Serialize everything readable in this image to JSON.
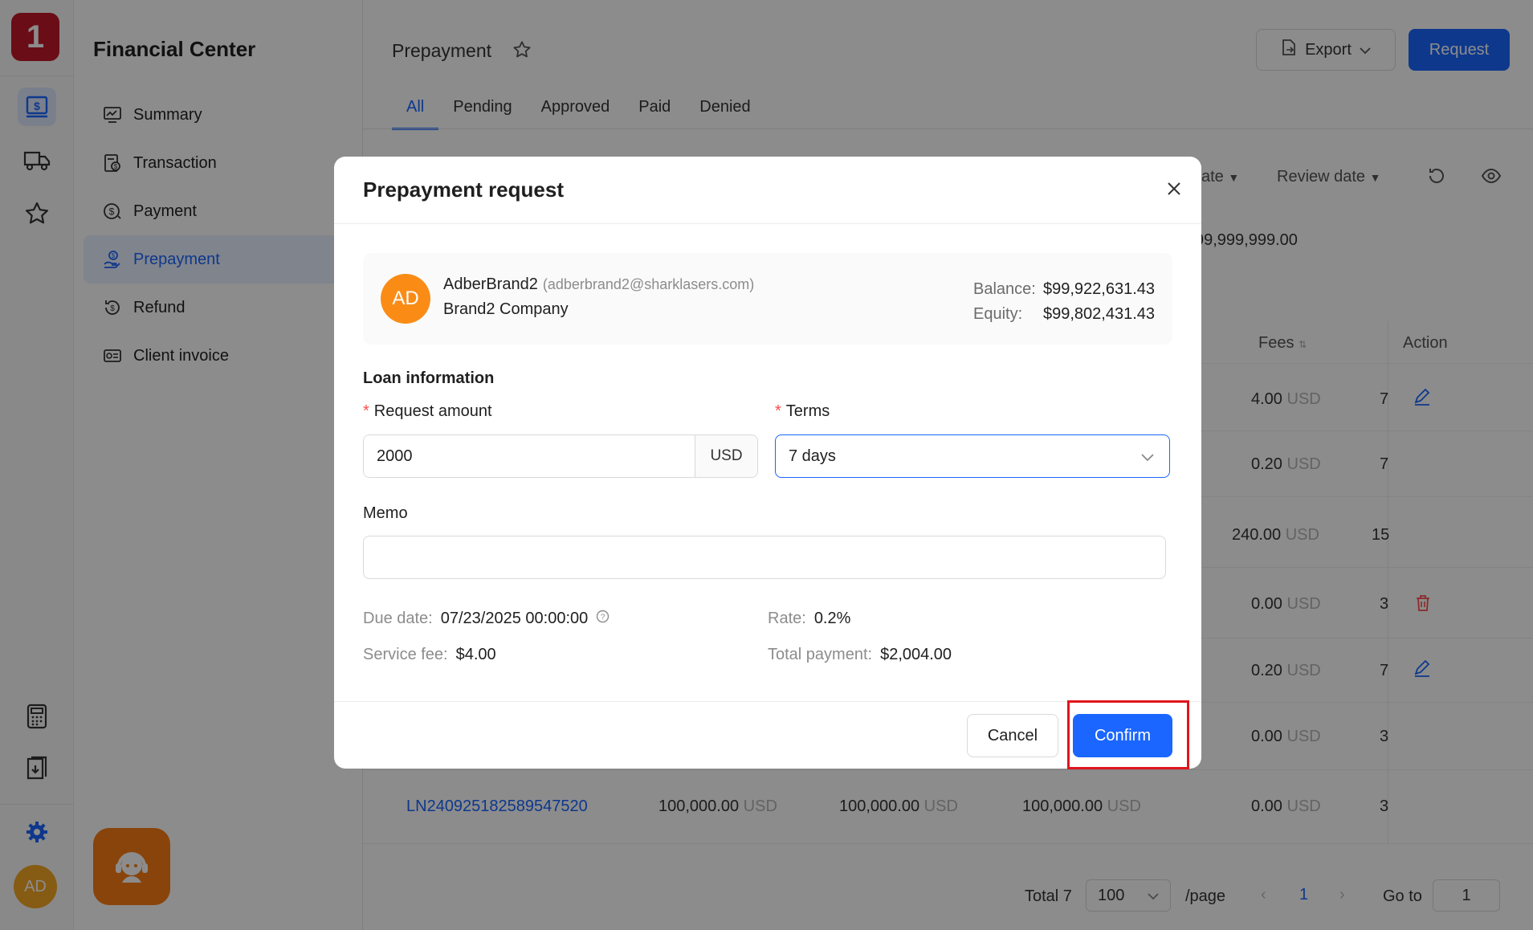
{
  "rail": {
    "logo_text": "1",
    "avatar_text": "AD",
    "icons": [
      "finance-icon",
      "truck-icon",
      "star-icon",
      "calculator-icon",
      "invoice-download-icon",
      "gear-icon"
    ]
  },
  "sidenav": {
    "title": "Financial Center",
    "items": [
      {
        "label": "Summary",
        "icon": "chart-monitor-icon"
      },
      {
        "label": "Transaction",
        "icon": "transaction-icon"
      },
      {
        "label": "Payment",
        "icon": "dollar-circle-icon"
      },
      {
        "label": "Prepayment",
        "icon": "hand-dollar-icon",
        "active": true
      },
      {
        "label": "Refund",
        "icon": "refund-icon"
      },
      {
        "label": "Client invoice",
        "icon": "invoice-icon"
      }
    ]
  },
  "header": {
    "title": "Prepayment",
    "export_label": "Export",
    "request_label": "Request"
  },
  "tabs": [
    "All",
    "Pending",
    "Approved",
    "Paid",
    "Denied"
  ],
  "filters": {
    "date_partial": "ate",
    "review_date": "Review date",
    "amount_partial": "99,999,999.00"
  },
  "table": {
    "headers": {
      "fees": "Fees",
      "action": "Action"
    },
    "fees": [
      {
        "value": "4.00",
        "unit": "USD",
        "tail": "7"
      },
      {
        "value": "0.20",
        "unit": "USD",
        "tail": "7"
      },
      {
        "value": "240.00",
        "unit": "USD",
        "tail": "15"
      },
      {
        "value": "0.00",
        "unit": "USD",
        "tail": "3"
      },
      {
        "value": "0.20",
        "unit": "USD",
        "tail": "7"
      },
      {
        "value": "0.00",
        "unit": "USD",
        "tail": "3"
      },
      {
        "value": "0.00",
        "unit": "USD",
        "tail": "3"
      }
    ],
    "last_row": {
      "id": "LN240925182589547520",
      "amount1": "100,000.00",
      "amount2": "100,000.00",
      "amount3": "100,000.00",
      "unit": "USD"
    }
  },
  "pagination": {
    "total": "Total 7",
    "page_size": "100",
    "per_page": "/page",
    "current": "1",
    "goto_label": "Go to",
    "goto_value": "1"
  },
  "modal": {
    "title": "Prepayment request",
    "account": {
      "initials": "AD",
      "name": "AdberBrand2",
      "email": "(adberbrand2@sharklasers.com)",
      "company": "Brand2 Company",
      "balance_label": "Balance:",
      "balance_value": "$99,922,631.43",
      "equity_label": "Equity:",
      "equity_value": "$99,802,431.43"
    },
    "section_title": "Loan information",
    "request_amount_label": "Request amount",
    "request_amount_value": "2000",
    "currency": "USD",
    "terms_label": "Terms",
    "terms_value": "7 days",
    "memo_label": "Memo",
    "memo_value": "",
    "due_date_label": "Due date:",
    "due_date_value": "07/23/2025 00:00:00",
    "rate_label": "Rate:",
    "rate_value": "0.2%",
    "service_fee_label": "Service fee:",
    "service_fee_value": "$4.00",
    "total_payment_label": "Total payment:",
    "total_payment_value": "$2,004.00",
    "cancel_label": "Cancel",
    "confirm_label": "Confirm"
  },
  "colors": {
    "primary": "#1a66ff",
    "logo": "#c21829",
    "avatar": "#fa8c16",
    "highlight": "#e0161d"
  }
}
